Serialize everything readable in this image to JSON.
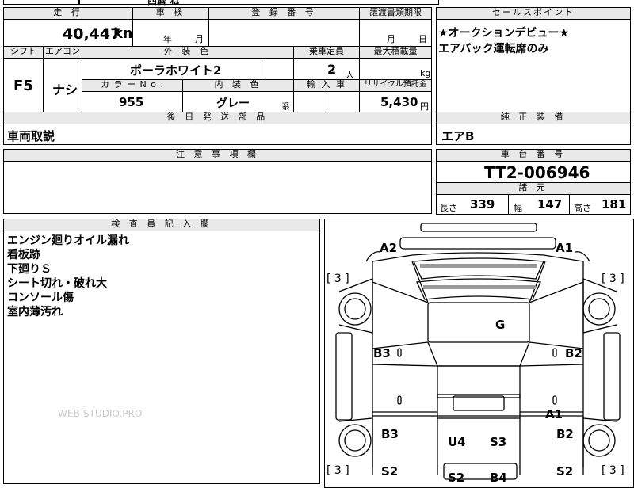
{
  "header": {
    "mileage_label": "走 行",
    "shaken_label": "車 検",
    "reg_label": "登 録 番 号",
    "transfer_label": "譲渡書類期限",
    "sales_label": "セールスポイント",
    "top_partial": "西暦 ね"
  },
  "mileage": {
    "value": "40,447",
    "unit": "km"
  },
  "shaken": {
    "year": "年",
    "month": "月"
  },
  "transfer": {
    "month": "月",
    "day": "日"
  },
  "sales_points": [
    "★オークションデビュー★",
    "エアバック運転席のみ"
  ],
  "labels": {
    "shift": "シフト",
    "aircon": "エアコン",
    "exterior": "外 装 色",
    "capacity": "乗車定員",
    "max_load": "最大積載量",
    "color_no": "カ ラ ー N o .",
    "interior": "内 装 色",
    "import": "輸 入 車",
    "recycle": "リサイクル預託金",
    "later_parts": "後 日 発 送 部 品",
    "genuine_equipment": "純 正 装 備",
    "notes": "注 意 事 項 欄",
    "chassis": "車 台 番 号",
    "specs": "諸 元",
    "inspector": "検 査 員 記 入 欄"
  },
  "vehicle": {
    "shift": "F5",
    "aircon": "ナシ",
    "exterior_color": "ポーラホワイト2",
    "capacity": "2",
    "capacity_unit": "人",
    "load_unit": "kg",
    "color_no": "955",
    "interior_color": "グレー",
    "interior_suffix": "系",
    "recycle_fee": "5,430",
    "recycle_unit": "円"
  },
  "later_parts": "車両取説",
  "genuine_equipment": "エアB",
  "chassis_no": "TT2-006946",
  "dimensions": {
    "length_label": "長さ",
    "length": "339",
    "width_label": "幅",
    "width": "147",
    "height_label": "高さ",
    "height": "181"
  },
  "inspector_notes": [
    "エンジン廻りオイル漏れ",
    "看板跡",
    "下廻りＳ",
    "シート切れ・破れ大",
    "コンソール傷",
    "室内薄汚れ"
  ],
  "watermark": "WEB-STUDIO.PRO",
  "diagram": {
    "tire_front_left": "[ 3 ]",
    "tire_front_right": "[ 3 ]",
    "tire_rear_left": "[ 3 ]",
    "tire_rear_right": "[ 3 ]",
    "marks": {
      "a2": "A2",
      "a1_top": "A1",
      "g": "G",
      "b3_upper": "B3",
      "b2_upper": "B2",
      "a1_lower": "A1",
      "b3_lower": "B3",
      "u4": "U4",
      "s3": "S3",
      "b2_lower": "B2",
      "s2_left": "S2",
      "s2_right": "S2",
      "s2_center": "S2",
      "b4": "B4"
    }
  }
}
